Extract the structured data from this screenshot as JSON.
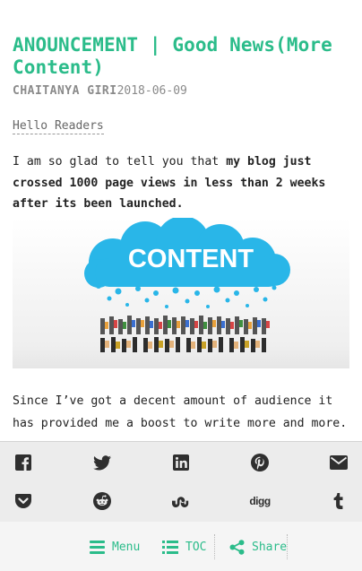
{
  "post": {
    "title": "ANOUNCEMENT | Good News(More Content)",
    "author": "CHAITANYA GIRI",
    "date": "2018-06-09",
    "greeting": "Hello Readers",
    "para1_lead": "I am so glad to tell you that ",
    "para1_bold": "my blog just crossed 1000 page views in less than 2 weeks after its been launched.",
    "image_text": "CONTENT",
    "para2": "Since I’ve got a decent amount of audience it has provided me a boost to write more and more."
  },
  "share": {
    "row1": [
      "facebook-icon",
      "twitter-icon",
      "linkedin-icon",
      "pinterest-icon",
      "mail-icon"
    ],
    "row2": [
      "pocket-icon",
      "reddit-icon",
      "stumbleupon-icon",
      "digg-icon",
      "tumblr-icon"
    ],
    "digg_label": "digg"
  },
  "nav": {
    "menu_label": "Menu",
    "toc_label": "TOC",
    "share_label": "Share"
  },
  "colors": {
    "accent": "#2bbc8a",
    "cloud": "#29b6e8"
  }
}
